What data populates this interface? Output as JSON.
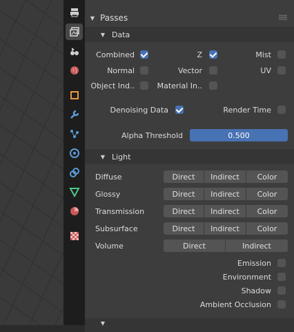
{
  "properties": {
    "passes_panel": {
      "title": "Passes",
      "data_section": {
        "title": "Data",
        "toggles": [
          {
            "label": "Combined",
            "checked": true
          },
          {
            "label": "Z",
            "checked": true
          },
          {
            "label": "Mist",
            "checked": false
          },
          {
            "label": "Normal",
            "checked": false
          },
          {
            "label": "Vector",
            "checked": false
          },
          {
            "label": "UV",
            "checked": false
          },
          {
            "label": "Object Ind..",
            "checked": false
          },
          {
            "label": "Material In..",
            "checked": false
          }
        ],
        "denoising_data": {
          "label": "Denoising Data",
          "checked": true
        },
        "render_time": {
          "label": "Render Time",
          "checked": false
        },
        "alpha_threshold": {
          "label": "Alpha Threshold",
          "value": "0.500"
        }
      },
      "light_section": {
        "title": "Light",
        "rows": [
          {
            "label": "Diffuse",
            "buttons": [
              "Direct",
              "Indirect",
              "Color"
            ]
          },
          {
            "label": "Glossy",
            "buttons": [
              "Direct",
              "Indirect",
              "Color"
            ]
          },
          {
            "label": "Transmission",
            "buttons": [
              "Direct",
              "Indirect",
              "Color"
            ]
          },
          {
            "label": "Subsurface",
            "buttons": [
              "Direct",
              "Indirect",
              "Color"
            ]
          },
          {
            "label": "Volume",
            "buttons": [
              "Direct",
              "Indirect"
            ]
          }
        ],
        "toggles": [
          {
            "label": "Emission",
            "checked": false
          },
          {
            "label": "Environment",
            "checked": false
          },
          {
            "label": "Shadow",
            "checked": false
          },
          {
            "label": "Ambient Occlusion",
            "checked": false
          }
        ]
      }
    }
  },
  "tabs": [
    "output-icon",
    "view-layer-icon",
    "scene-icon",
    "world-icon",
    "object-icon",
    "modifier-icon",
    "particles-icon",
    "physics-icon",
    "constraints-icon",
    "object-data-icon",
    "material-icon",
    "texture-icon"
  ],
  "colors": {
    "accent": "#4772b3",
    "panel": "#3d3d3d",
    "tabbar": "#1d1d1d",
    "widget": "#545454"
  }
}
